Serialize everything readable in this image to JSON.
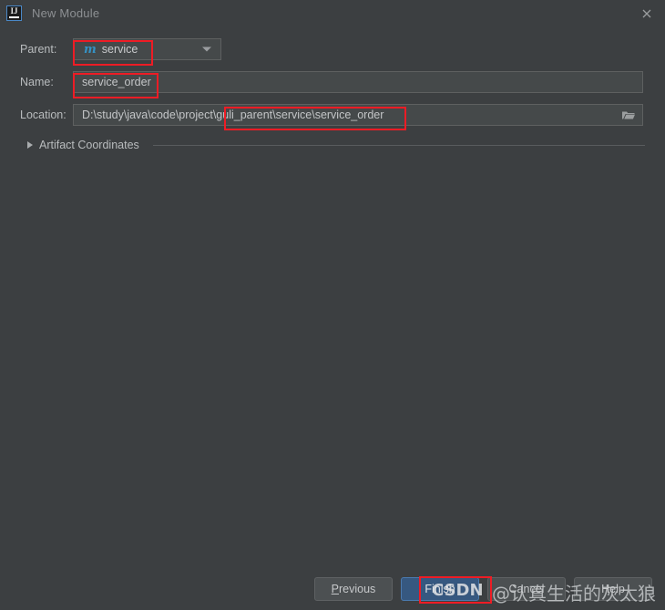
{
  "window": {
    "title": "New Module",
    "app_icon": "intellij-idea-icon",
    "close_icon": "close-icon"
  },
  "form": {
    "parent": {
      "label": "Parent:",
      "value": "service",
      "icon": "maven-module-icon",
      "icon_glyph": "m",
      "dropdown_icon": "chevron-down-icon"
    },
    "name": {
      "label": "Name:",
      "value": "service_order",
      "placeholder": ""
    },
    "location": {
      "label": "Location:",
      "value": "D:\\study\\java\\code\\project\\guli_parent\\service\\service_order",
      "browse_icon": "folder-icon"
    },
    "artifact": {
      "label": "Artifact Coordinates",
      "expand_icon": "triangle-right-icon",
      "expanded": false
    }
  },
  "buttons": {
    "previous": "Previous",
    "previous_mnemonic": "P",
    "previous_rest": "revious",
    "finish": "Finish",
    "cancel": "Cancel",
    "help": "Help"
  },
  "annotations": {
    "highlight_color": "#ee1c25",
    "boxes": [
      {
        "name": "parent-value-highlight"
      },
      {
        "name": "name-value-highlight"
      },
      {
        "name": "location-suffix-highlight"
      },
      {
        "name": "finish-button-highlight"
      }
    ]
  },
  "watermark": {
    "brand": "CSDN",
    "author": "@认真生活的灰太狼"
  }
}
